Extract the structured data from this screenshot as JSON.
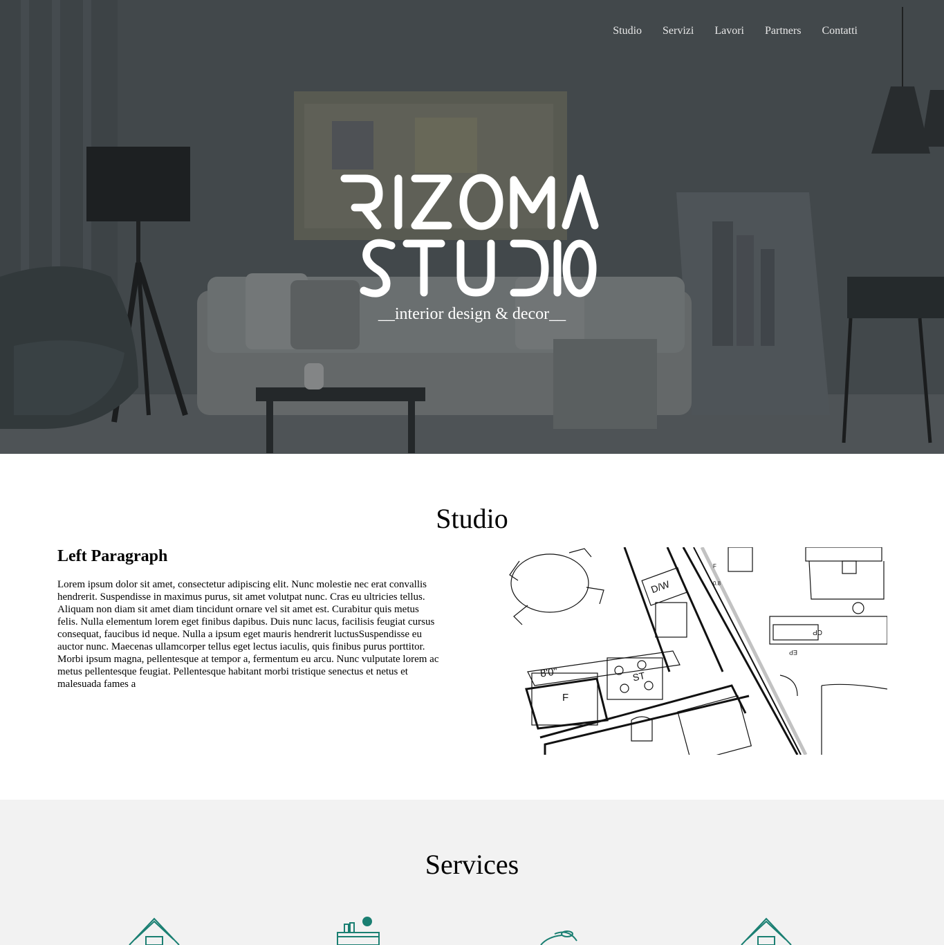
{
  "nav": {
    "items": [
      "Studio",
      "Servizi",
      "Lavori",
      "Partners",
      "Contatti"
    ]
  },
  "hero": {
    "logo_line1": "RIZOMA",
    "logo_line2": "STUDIO",
    "tagline": "__interior design & decor__"
  },
  "studio": {
    "title": "Studio",
    "subtitle": "Left Paragraph",
    "body": "Lorem ipsum dolor sit amet, consectetur adipiscing elit. Nunc molestie nec erat convallis hendrerit. Suspendisse in maximus purus, sit amet volutpat nunc. Cras eu ultricies tellus. Aliquam non diam sit amet diam tincidunt ornare vel sit amet est. Curabitur quis metus felis. Nulla elementum lorem eget finibus dapibus. Duis nunc lacus, facilisis feugiat cursus consequat, faucibus id neque. Nulla a ipsum eget mauris hendrerit luctusSuspendisse eu auctor nunc. Maecenas ullamcorper tellus eget lectus iaculis, quis finibus purus porttitor. Morbi ipsum magna, pellentesque at tempor a, fermentum eu arcu. Nunc vulputate lorem ac metus pellentesque feugiat. Pellentesque habitant morbi tristique senectus et netus et malesuada fames a",
    "plan_labels": {
      "dw": "D/W",
      "dim": "8'0\"",
      "fridge": "F",
      "stove": "ST",
      "cp": "CP",
      "ep": "EP",
      "f_small": "F",
      "dim2": "0.8"
    }
  },
  "services": {
    "title": "Services",
    "icons": [
      "house-tools-icon",
      "desk-icon",
      "lamp-icon",
      "house-tools-icon"
    ]
  },
  "colors": {
    "accent": "#1a7f72",
    "services_bg": "#f2f2f2"
  }
}
